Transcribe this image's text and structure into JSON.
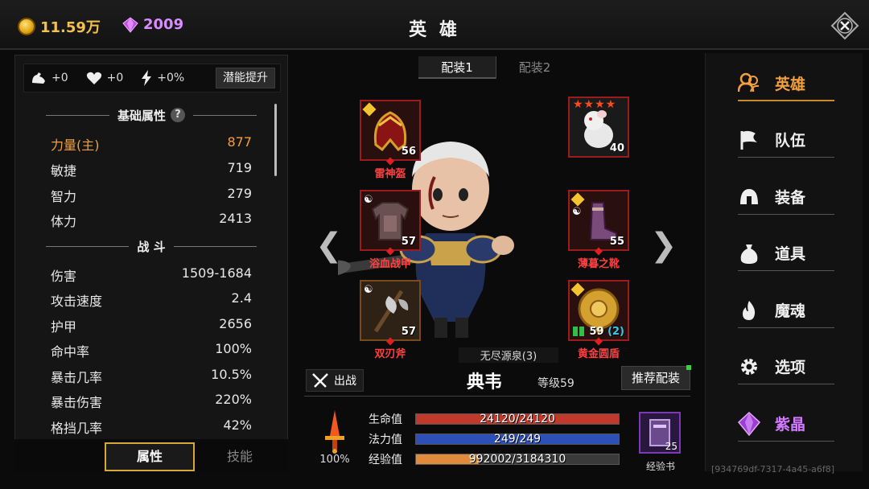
{
  "topbar": {
    "gold": "11.59万",
    "gems": "2009",
    "title": "英 雄"
  },
  "bonus": {
    "strength": "+0",
    "health": "+0",
    "energy": "+0%",
    "potential_label": "潜能提升"
  },
  "attributes": {
    "basic_title": "基础属性",
    "help": "?",
    "basic": [
      {
        "label": "力量(主)",
        "value": "877"
      },
      {
        "label": "敏捷",
        "value": "719"
      },
      {
        "label": "智力",
        "value": "279"
      },
      {
        "label": "体力",
        "value": "2413"
      }
    ],
    "combat_title": "战 斗",
    "combat": [
      {
        "label": "伤害",
        "value": "1509-1684"
      },
      {
        "label": "攻击速度",
        "value": "2.4"
      },
      {
        "label": "护甲",
        "value": "2656"
      },
      {
        "label": "命中率",
        "value": "100%"
      },
      {
        "label": "暴击几率",
        "value": "10.5%"
      },
      {
        "label": "暴击伤害",
        "value": "220%"
      },
      {
        "label": "格挡几率",
        "value": "42%"
      }
    ]
  },
  "left_tabs": {
    "attributes": "属性",
    "skills": "技能"
  },
  "loadouts": [
    "配装1",
    "配装2"
  ],
  "equipment": {
    "helmet": {
      "name": "雷神盔",
      "level": "56"
    },
    "armor": {
      "name": "浴血战甲",
      "level": "57"
    },
    "weapon": {
      "name": "双刃斧",
      "level": "57"
    },
    "pet": {
      "level": "40"
    },
    "boots": {
      "name": "薄暮之靴",
      "level": "55"
    },
    "shield": {
      "name": "黄金圆盾",
      "level": "59",
      "bonus": "(2)"
    }
  },
  "fountain": "无尽源泉(3)",
  "hero": {
    "fight_label": "出战",
    "name": "典韦",
    "level": "等级59",
    "recommend_label": "推荐配装"
  },
  "power": {
    "value": "100%"
  },
  "bars": {
    "hp": {
      "label": "生命值",
      "text": "24120/24120",
      "fraction": 1.0,
      "color": "#c0392b"
    },
    "mp": {
      "label": "法力值",
      "text": "249/249",
      "fraction": 1.0,
      "color": "#2c4fb8"
    },
    "exp": {
      "label": "经验值",
      "text": "992002/3184310",
      "fraction": 0.3115,
      "color": "#e08a3c"
    }
  },
  "exp_book": {
    "count": "25",
    "label": "经验书"
  },
  "nav": [
    {
      "label": "英雄",
      "icon": "heroes-icon"
    },
    {
      "label": "队伍",
      "icon": "flag-icon"
    },
    {
      "label": "装备",
      "icon": "helmet-icon"
    },
    {
      "label": "道具",
      "icon": "bag-icon"
    },
    {
      "label": "魔魂",
      "icon": "flame-icon"
    },
    {
      "label": "选项",
      "icon": "gear-icon"
    },
    {
      "label": "紫晶",
      "icon": "amethyst-icon"
    }
  ],
  "build_id": "[934769df-7317-4a45-a6f8]"
}
